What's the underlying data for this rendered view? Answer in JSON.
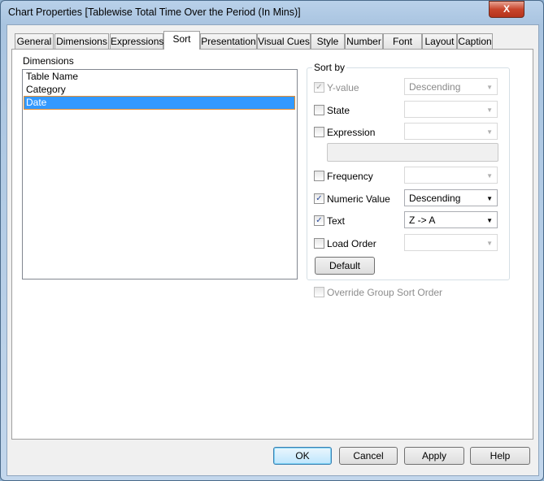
{
  "window": {
    "title": "Chart Properties [Tablewise Total Time Over the Period (In Mins)]",
    "close": "X"
  },
  "tabs": [
    "General",
    "Dimensions",
    "Expressions",
    "Sort",
    "Presentation",
    "Visual Cues",
    "Style",
    "Number",
    "Font",
    "Layout",
    "Caption"
  ],
  "selected_tab": "Sort",
  "dimensions": {
    "label": "Dimensions",
    "items": [
      "Table Name",
      "Category",
      "Date"
    ],
    "selected": "Date"
  },
  "sort_by": {
    "label": "Sort by",
    "y_value": {
      "label": "Y-value",
      "checked": true,
      "disabled": true,
      "value": "Descending"
    },
    "state": {
      "label": "State",
      "checked": false,
      "value": ""
    },
    "expression": {
      "label": "Expression",
      "checked": false,
      "value": "",
      "expr": ""
    },
    "frequency": {
      "label": "Frequency",
      "checked": false,
      "value": ""
    },
    "numeric_value": {
      "label": "Numeric Value",
      "checked": true,
      "value": "Descending"
    },
    "text": {
      "label": "Text",
      "checked": true,
      "value": "Z -> A"
    },
    "load_order": {
      "label": "Load Order",
      "checked": false,
      "value": ""
    },
    "default_button": "Default"
  },
  "override": {
    "label": "Override Group Sort Order",
    "checked": false,
    "disabled": true
  },
  "buttons": {
    "ok": "OK",
    "cancel": "Cancel",
    "apply": "Apply",
    "help": "Help"
  }
}
